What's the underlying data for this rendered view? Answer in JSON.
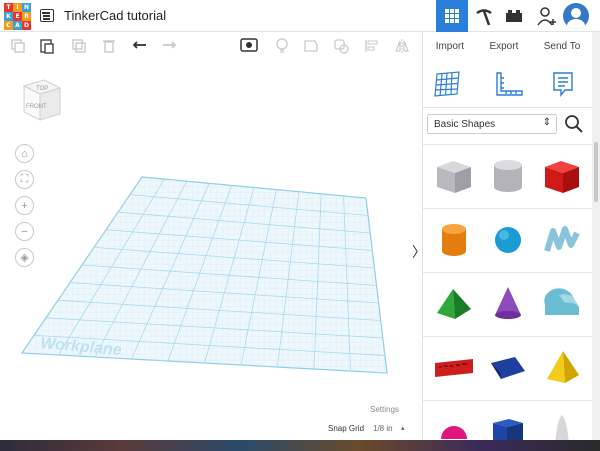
{
  "app": {
    "title": "TinkerCad tutorial",
    "logo_letters": [
      "T",
      "I",
      "N",
      "K",
      "E",
      "R",
      "C",
      "A",
      "D"
    ]
  },
  "toolbar": {
    "icons": [
      "copy-icon",
      "paste-icon",
      "duplicate-icon",
      "delete-icon",
      "undo-icon",
      "redo-icon",
      "notes-icon",
      "light-icon",
      "shape-icon",
      "group-icon",
      "align-icon",
      "mirror-icon"
    ]
  },
  "right_panel": {
    "actions": {
      "import": "Import",
      "export": "Export",
      "send_to": "Send To"
    },
    "shapes_selector": {
      "value": "Basic Shapes"
    },
    "shapes": [
      [
        "box",
        "cylinder",
        "box-red"
      ],
      [
        "cylinder-orange",
        "sphere",
        "scribble"
      ],
      [
        "roof",
        "cone",
        "round-roof"
      ],
      [
        "text",
        "wedge",
        "pyramid"
      ],
      [
        "half-sphere",
        "cube-blue",
        "paraboloid"
      ]
    ]
  },
  "viewport": {
    "view_cube": {
      "top": "TOP",
      "front": "FRONT"
    },
    "workplane_label": "Workplane",
    "settings": "Settings",
    "snap_grid_label": "Snap Grid",
    "snap_grid_value": "1/8 in"
  },
  "colors": {
    "accent": "#2a7ed9",
    "grid": "#b7dff0"
  }
}
